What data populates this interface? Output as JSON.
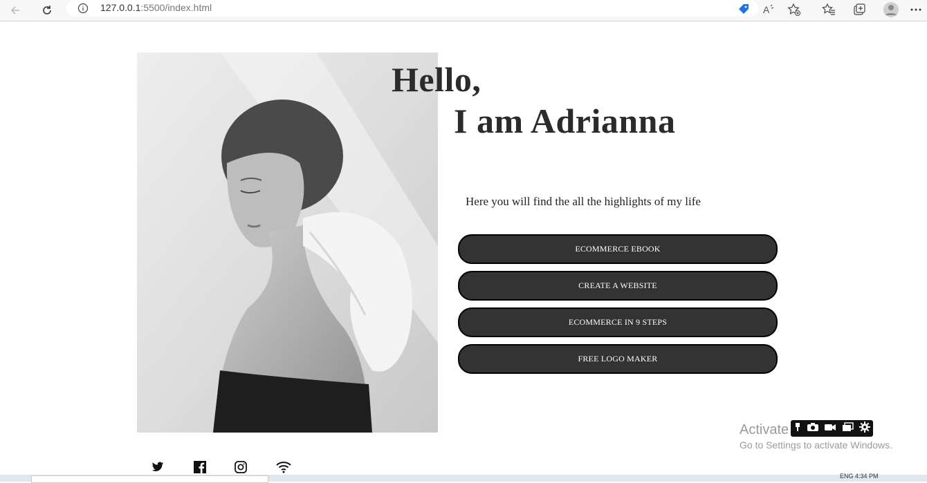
{
  "browser": {
    "url_host": "127.0.0.1",
    "url_rest": ":5500/index.html",
    "icons": [
      "back-icon",
      "reload-icon",
      "site-info-icon",
      "tag-icon",
      "read-aloud-icon",
      "add-favorite-icon",
      "favorites-icon",
      "collections-icon",
      "profile-icon",
      "more-icon"
    ]
  },
  "hero": {
    "greeting": "Hello,",
    "name": "I am Adrianna",
    "tagline": "Here you will find the all the highlights of my life"
  },
  "links": [
    {
      "label": "ECOMMERCE EBOOK"
    },
    {
      "label": "CREATE A WEBSITE"
    },
    {
      "label": "ECOMMERCE IN 9 STEPS"
    },
    {
      "label": "FREE LOGO MAKER"
    }
  ],
  "social": [
    "twitter-icon",
    "facebook-icon",
    "instagram-icon",
    "wifi-icon"
  ],
  "watermark": {
    "title": "Activate Windows",
    "subtitle": "Go to Settings to activate Windows."
  },
  "taskbar": {
    "tray_text": "ENG     4:34 PM"
  },
  "colors": {
    "button_bg": "#333333",
    "button_border": "#000000",
    "heading": "#2b2b2b"
  }
}
